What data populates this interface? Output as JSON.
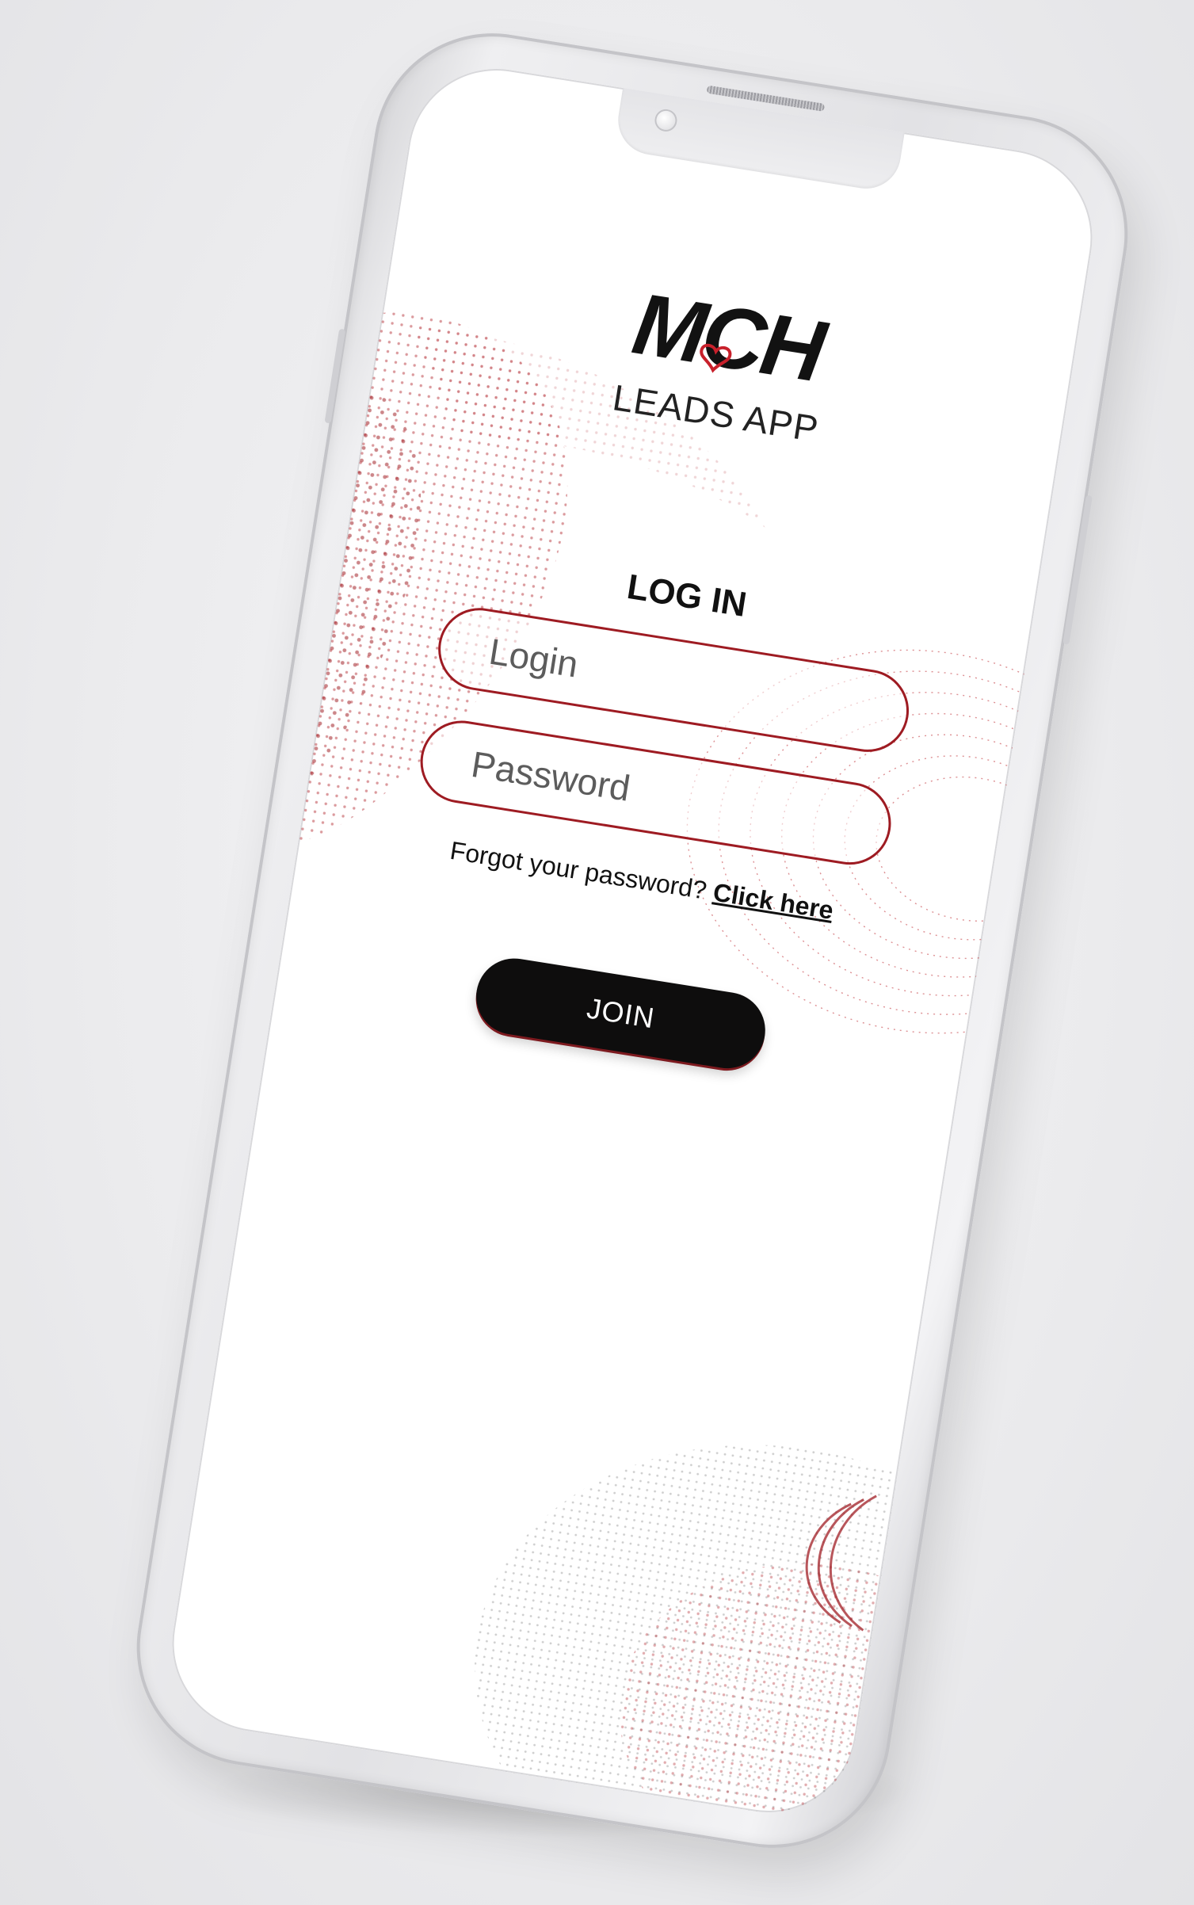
{
  "brand": {
    "logo_text": "MCH",
    "subtitle": "LEADS APP",
    "accent_color": "#9e1b22",
    "heart_color": "#c8202b"
  },
  "login_form": {
    "heading": "LOG IN",
    "login_placeholder": "Login",
    "password_placeholder": "Password",
    "forgot_text": "Forgot your password?",
    "forgot_link": "Click here",
    "join_label": "JOIN"
  },
  "icons": {
    "logo": "mch-heart-logo",
    "camera": "front-camera",
    "speaker": "earpiece-speaker"
  },
  "colors": {
    "button_bg": "#0e0d0d",
    "field_border": "#9e1b22",
    "dots": "#b3262d",
    "phone_frame": "#e2e2e5"
  }
}
